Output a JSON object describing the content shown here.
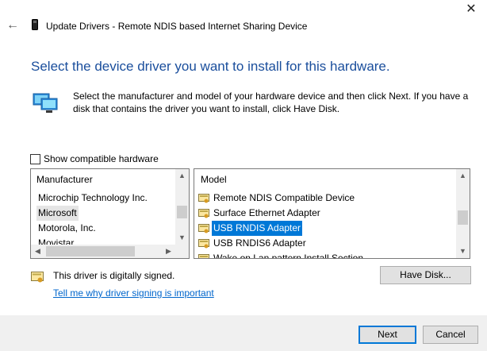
{
  "titlebar": {
    "back_icon": "back-arrow-icon",
    "device_icon": "usb-device-icon",
    "title": "Update Drivers - Remote NDIS based Internet Sharing Device",
    "close_icon": "close-icon",
    "close_glyph": "✕",
    "back_glyph": "←"
  },
  "heading": "Select the device driver you want to install for this hardware.",
  "instructions": "Select the manufacturer and model of your hardware device and then click Next. If you have a disk that contains the driver you want to install, click Have Disk.",
  "show_compatible": {
    "label": "Show compatible hardware",
    "checked": false
  },
  "manufacturer_list": {
    "header": "Manufacturer",
    "items": [
      "Microchip Technology Inc.",
      "Microsoft",
      "Motorola, Inc.",
      "Movistar"
    ],
    "selected": "Microsoft"
  },
  "model_list": {
    "header": "Model",
    "items": [
      "Remote NDIS Compatible Device",
      "Surface Ethernet Adapter",
      "USB RNDIS Adapter",
      "USB RNDIS6 Adapter",
      "Wake on Lan pattern Install Section"
    ],
    "selected": "USB RNDIS Adapter"
  },
  "signed_text": "This driver is digitally signed.",
  "signing_link": "Tell me why driver signing is important",
  "buttons": {
    "have_disk": "Have Disk...",
    "next": "Next",
    "cancel": "Cancel"
  },
  "scroll_glyphs": {
    "up": "▲",
    "down": "▼",
    "left": "◀",
    "right": "▶"
  },
  "colors": {
    "heading": "#1a4e9c",
    "selection": "#0078d7",
    "link": "#0066cc"
  }
}
